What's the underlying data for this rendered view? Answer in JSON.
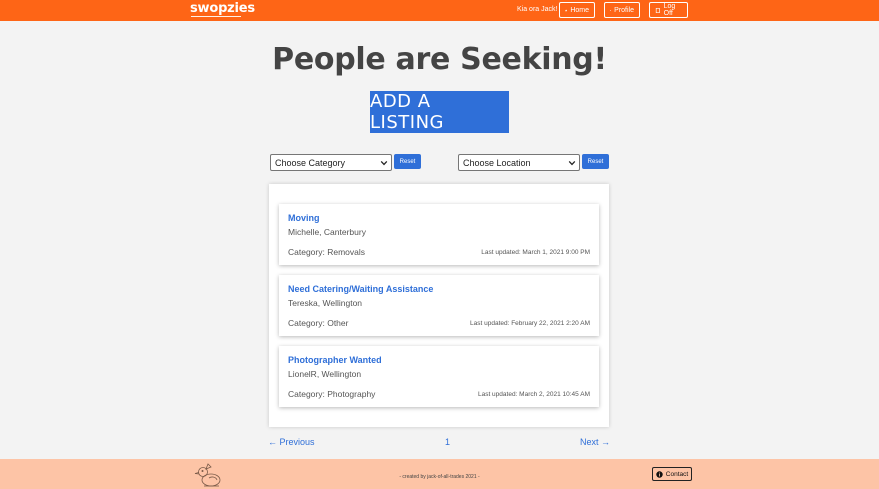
{
  "nav": {
    "logo": "swopzies",
    "greeting": "Kia ora Jack!",
    "home_label": "Home",
    "profile_label": "Profile",
    "logoff_label": "Log Off"
  },
  "hero": {
    "title": "People are Seeking!",
    "add_listing_label": "ADD A LISTING"
  },
  "filters": {
    "category_selected": "Choose Category",
    "location_selected": "Choose Location",
    "reset_label": "Reset"
  },
  "listings": [
    {
      "title": "Moving",
      "author": "Michelle, Canterbury",
      "category": "Category: Removals",
      "updated": "Last updated: March 1, 2021 9:00 PM"
    },
    {
      "title": "Need Catering/Waiting Assistance",
      "author": "Tereska, Wellington",
      "category": "Category: Other",
      "updated": "Last updated: February 22, 2021 2:20 AM"
    },
    {
      "title": "Photographer Wanted",
      "author": "LionelR, Wellington",
      "category": "Category: Photography",
      "updated": "Last updated: March 2, 2021 10:45 AM"
    }
  ],
  "pagination": {
    "previous_label": "← Previous",
    "current_page": "1",
    "next_label": "Next →"
  },
  "footer": {
    "credit": "- created by jack-of-all-trades 2021 -",
    "contact_label": "Contact"
  },
  "colors": {
    "brand_orange": "#fe6516",
    "accent_blue": "#2f6fd8",
    "footer_peach": "#fdc4a6"
  }
}
